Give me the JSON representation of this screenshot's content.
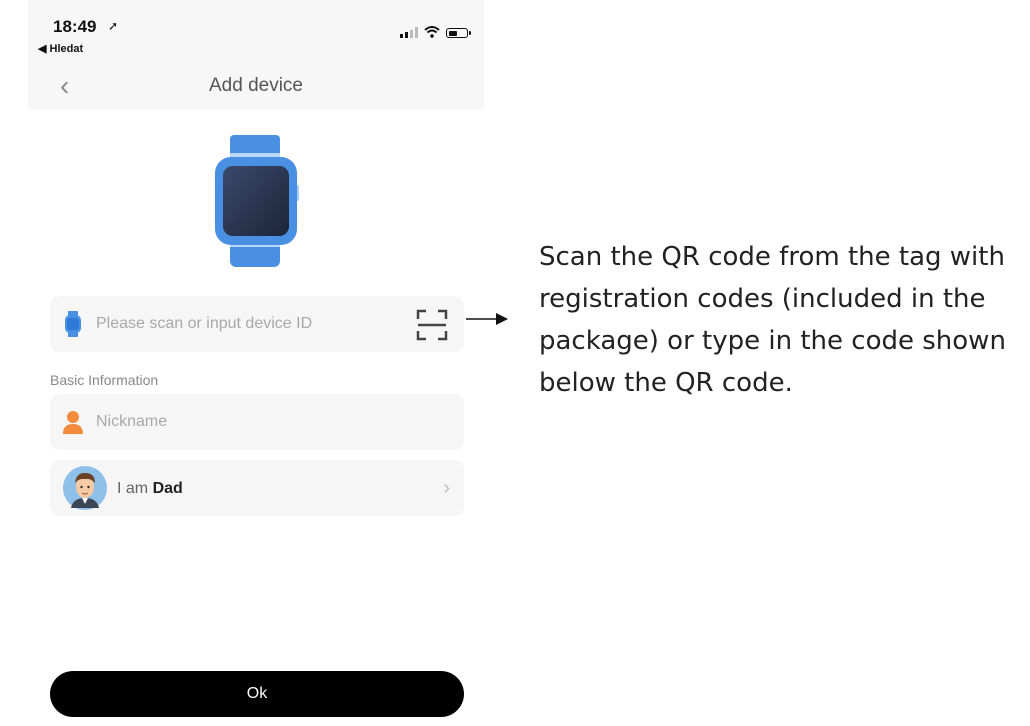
{
  "status_bar": {
    "time": "18:49",
    "back_app": "◀ Hledat"
  },
  "nav": {
    "title": "Add device"
  },
  "device_id": {
    "placeholder": "Please scan or input device ID"
  },
  "basic_info": {
    "section_label": "Basic Information",
    "nickname_placeholder": "Nickname",
    "role_prefix": "I am",
    "role_value": "Dad"
  },
  "ok_button": "Ok",
  "annotation": "Scan the QR code from the tag with registration codes (included in the package) or type in the code shown below the QR code.",
  "colors": {
    "watch_blue": "#4a90e2",
    "person_orange": "#f28b3c",
    "button_black": "#000000"
  }
}
